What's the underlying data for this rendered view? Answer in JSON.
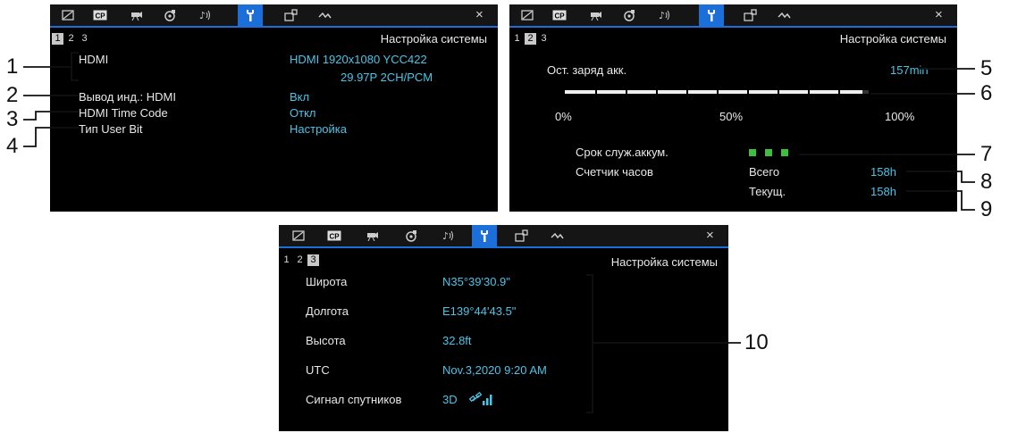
{
  "screens": [
    {
      "pages": [
        "1",
        "2",
        "3"
      ],
      "selected_page": "1",
      "title": "Настройка системы",
      "rows": [
        {
          "label": "HDMI",
          "value": "HDMI   1920x1080 YCC422",
          "value2": "29.97P   2CH/PCM"
        },
        {
          "label": "Вывод инд.: HDMI",
          "value": "Вкл"
        },
        {
          "label": "HDMI Time Code",
          "value": "Откл"
        },
        {
          "label": "Тип User Bit",
          "value": "Настройка"
        }
      ]
    },
    {
      "pages": [
        "1",
        "2",
        "3"
      ],
      "selected_page": "2",
      "title": "Настройка системы",
      "battery_label": "Ост. заряд акк.",
      "battery_value": "157min",
      "battery_level": 0.98,
      "scale": [
        "0%",
        "50%",
        "100%"
      ],
      "life_label": "Срок служ.аккум.",
      "life_indicator_count": 3,
      "hours_label": "Счетчик часов",
      "total_label": "Всего",
      "total_value": "158h",
      "current_label": "Текущ.",
      "current_value": "158h"
    },
    {
      "pages": [
        "1",
        "2",
        "3"
      ],
      "selected_page": "3",
      "title": "Настройка системы",
      "rows": [
        {
          "label": "Широта",
          "value": "N35°39'30.9\""
        },
        {
          "label": "Долгота",
          "value": "E139°44'43.5\""
        },
        {
          "label": "Высота",
          "value": "32.8ft"
        },
        {
          "label": "UTC",
          "value": "Nov.3,2020 9:20 AM"
        },
        {
          "label": "Сигнал спутников",
          "value": "3D"
        }
      ]
    }
  ],
  "tabs": [
    "camera-settings-icon",
    "cp-icon",
    "video-camera-icon",
    "recording-media-icon",
    "audio-icon",
    "wrench-icon",
    "assignable-button-icon",
    "waveform-icon"
  ],
  "active_tab": "wrench-icon",
  "close_glyph": "×",
  "colors": {
    "accent": "#1c6fd8",
    "value_text": "#4ec3e6",
    "life_indicator": "#3fbf3f"
  },
  "callouts": [
    "1",
    "2",
    "3",
    "4",
    "5",
    "6",
    "7",
    "8",
    "9",
    "10"
  ]
}
